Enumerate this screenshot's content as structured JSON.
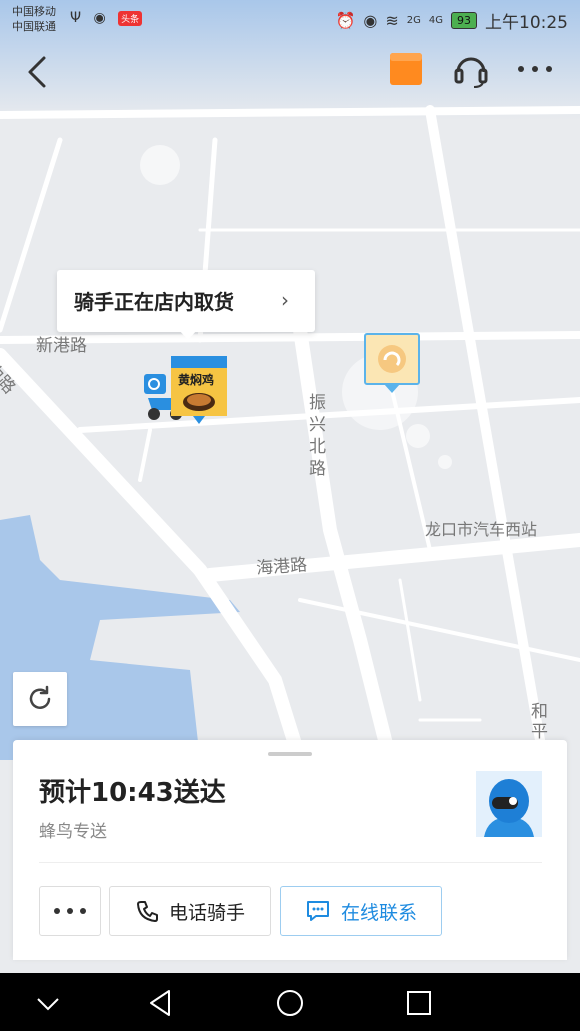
{
  "status_bar": {
    "carrier1": "中国移动",
    "carrier2": "中国联通",
    "toutiao": "头条",
    "net1": "2G",
    "net2": "4G",
    "battery": "93",
    "time": "上午10:25"
  },
  "map": {
    "tooltip": "骑手正在店内取货",
    "shop_sign": "黄焖鸡",
    "roads": {
      "xingang": "新港路",
      "zhong": "中路",
      "zhenxing": "振兴北路",
      "haigang": "海港路",
      "station": "龙口市汽车西站",
      "he": "和平"
    }
  },
  "order": {
    "eta": "预计10:43送达",
    "delivery_by": "蜂鸟专送",
    "call_label": "电话骑手",
    "chat_label": "在线联系"
  },
  "colors": {
    "accent": "#1e8be0",
    "package_orange": "#ff8a1f",
    "water": "#a9c7ea",
    "map_bg": "#e9ebee"
  },
  "icons": {
    "back": "back-arrow-icon",
    "package": "package-icon",
    "headset": "headset-icon",
    "more": "more-dots-icon",
    "refresh": "refresh-icon",
    "phone": "phone-icon",
    "chat": "chat-icon"
  }
}
